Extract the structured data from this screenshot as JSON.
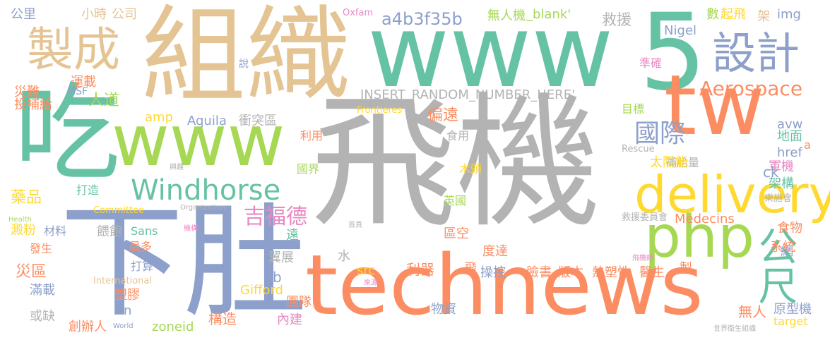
{
  "palette": {
    "green": "#66c2a5",
    "orange": "#fc8d62",
    "blue": "#8da0cb",
    "pink": "#e78ac3",
    "lime": "#a6d854",
    "yellow": "#ffd92f",
    "tan": "#e5c494",
    "gray": "#b3b3b3"
  },
  "words": [
    {
      "text": "飛機",
      "color": "#b3b3b3"
    },
    {
      "text": "組織",
      "color": "#e5c494"
    },
    {
      "text": "www",
      "color": "#66c2a5"
    },
    {
      "text": "5",
      "color": "#66c2a5"
    },
    {
      "text": "technews",
      "color": "#fc8d62"
    },
    {
      "text": "www",
      "color": "#a6d854"
    },
    {
      "text": "吃",
      "color": "#66c2a5"
    },
    {
      "text": "下肚",
      "color": "#8da0cb"
    },
    {
      "text": "tw",
      "color": "#fc8d62"
    },
    {
      "text": "delivery",
      "color": "#ffd92f"
    },
    {
      "text": "製成",
      "color": "#e5c494"
    },
    {
      "text": "設計",
      "color": "#8da0cb"
    },
    {
      "text": "php",
      "color": "#a6d854"
    },
    {
      "text": "公尺",
      "color": "#66c2a5"
    },
    {
      "text": "Windhorse",
      "color": "#66c2a5"
    },
    {
      "text": "Aerospace",
      "color": "#fc8d62"
    },
    {
      "text": "國際",
      "color": "#8da0cb"
    },
    {
      "text": "吉福德",
      "color": "#e78ac3"
    },
    {
      "text": "INSERT_RANDOM_NUMBER_HERE'",
      "color": "#b3b3b3"
    },
    {
      "text": "a4b3f35b",
      "color": "#8da0cb"
    },
    {
      "text": "無人機",
      "color": "#a6d854"
    },
    {
      "text": "_blank'",
      "color": "#a6d854"
    },
    {
      "text": "救援",
      "color": "#b3b3b3"
    },
    {
      "text": "Nigel",
      "color": "#8da0cb"
    },
    {
      "text": "起飛",
      "color": "#ffd92f"
    },
    {
      "text": "數",
      "color": "#a6d854"
    },
    {
      "text": "架",
      "color": "#e5c494"
    },
    {
      "text": "img",
      "color": "#8da0cb"
    },
    {
      "text": "Oxfam",
      "color": "#e78ac3"
    },
    {
      "text": "公里",
      "color": "#8da0cb"
    },
    {
      "text": "小時",
      "color": "#e5c494"
    },
    {
      "text": "公司",
      "color": "#e5c494"
    },
    {
      "text": "說",
      "color": "#8da0cb"
    },
    {
      "text": "運載",
      "color": "#fc8d62"
    },
    {
      "text": "災難",
      "color": "#fc8d62"
    },
    {
      "text": "MSF",
      "color": "#8da0cb"
    },
    {
      "text": "投補給",
      "color": "#fc8d62"
    },
    {
      "text": "人道",
      "color": "#a6d854"
    },
    {
      "text": "準確",
      "color": "#e78ac3"
    },
    {
      "text": "目標",
      "color": "#a6d854"
    },
    {
      "text": "avw",
      "color": "#8da0cb"
    },
    {
      "text": "地面",
      "color": "#66c2a5"
    },
    {
      "text": "a",
      "color": "#fc8d62"
    },
    {
      "text": "amp",
      "color": "#ffd92f"
    },
    {
      "text": "Aquila",
      "color": "#8da0cb"
    },
    {
      "text": "衝突區",
      "color": "#b3b3b3"
    },
    {
      "text": "偏遠",
      "color": "#fc8d62"
    },
    {
      "text": "Frontieres",
      "color": "#ffd92f"
    },
    {
      "text": "食用",
      "color": "#b3b3b3"
    },
    {
      "text": "href",
      "color": "#8da0cb"
    },
    {
      "text": "利用",
      "color": "#fc8d62"
    },
    {
      "text": "Rescue",
      "color": "#b3b3b3"
    },
    {
      "text": "軍機",
      "color": "#e78ac3"
    },
    {
      "text": "國界",
      "color": "#a6d854"
    },
    {
      "text": "木頭",
      "color": "#ffd92f"
    },
    {
      "text": "補給量",
      "color": "#b3b3b3"
    },
    {
      "text": "太陽能",
      "color": "#ffd92f"
    },
    {
      "text": "架構",
      "color": "#66c2a5"
    },
    {
      "text": "ck",
      "color": "#8da0cb"
    },
    {
      "text": "樂施會",
      "color": "#b3b3b3"
    },
    {
      "text": "藥品",
      "color": "#ffd92f"
    },
    {
      "text": "打造",
      "color": "#66c2a5"
    },
    {
      "text": "興趣",
      "color": "#b3b3b3"
    },
    {
      "text": "Committee",
      "color": "#ffd92f"
    },
    {
      "text": "Organization",
      "color": "#b3b3b3"
    },
    {
      "text": "英國",
      "color": "#a6d854"
    },
    {
      "text": "Health",
      "color": "#a6d854"
    },
    {
      "text": "機構",
      "color": "#e78ac3"
    },
    {
      "text": "首頁",
      "color": "#b3b3b3"
    },
    {
      "text": "救援委員會",
      "color": "#b3b3b3"
    },
    {
      "text": "Medecins",
      "color": "#fc8d62"
    },
    {
      "text": "食物",
      "color": "#fc8d62"
    },
    {
      "text": "網",
      "color": "#8da0cb"
    },
    {
      "text": "澱粉",
      "color": "#ffd92f"
    },
    {
      "text": "材料",
      "color": "#8da0cb"
    },
    {
      "text": "餵飽",
      "color": "#b3b3b3"
    },
    {
      "text": "Sans",
      "color": "#66c2a5"
    },
    {
      "text": "遠",
      "color": "#66c2a5"
    },
    {
      "text": "區空",
      "color": "#fc8d62"
    },
    {
      "text": "系統",
      "color": "#fc8d62"
    },
    {
      "text": "發生",
      "color": "#fc8d62"
    },
    {
      "text": "最多",
      "color": "#fc8d62"
    },
    {
      "text": "翼展",
      "color": "#b3b3b3"
    },
    {
      "text": "水",
      "color": "#b3b3b3"
    },
    {
      "text": "度達",
      "color": "#fc8d62"
    },
    {
      "text": "飛機師",
      "color": "#e78ac3"
    },
    {
      "text": "災區",
      "color": "#fc8d62"
    },
    {
      "text": "打算",
      "color": "#8da0cb"
    },
    {
      "text": "International",
      "color": "#e5c494"
    },
    {
      "text": "cb",
      "color": "#8da0cb"
    },
    {
      "text": "src",
      "color": "#ffd92f"
    },
    {
      "text": "利器",
      "color": "#fc8d62"
    },
    {
      "text": "飛",
      "color": "#fc8d62"
    },
    {
      "text": "操控",
      "color": "#8da0cb"
    },
    {
      "text": "臉書",
      "color": "#fc8d62"
    },
    {
      "text": "版本",
      "color": "#fc8d62"
    },
    {
      "text": "熱塑性",
      "color": "#fc8d62"
    },
    {
      "text": "醫生",
      "color": "#fc8d62"
    },
    {
      "text": "製",
      "color": "#fc8d62"
    },
    {
      "text": "滿載",
      "color": "#8da0cb"
    },
    {
      "text": "塑膠",
      "color": "#fc8d62"
    },
    {
      "text": "Gifford",
      "color": "#ffd92f"
    },
    {
      "text": "來源",
      "color": "#e78ac3"
    },
    {
      "text": "團隊",
      "color": "#fc8d62"
    },
    {
      "text": "物資",
      "color": "#8da0cb"
    },
    {
      "text": "無人",
      "color": "#fc8d62"
    },
    {
      "text": "原型機",
      "color": "#8da0cb"
    },
    {
      "text": "n",
      "color": "#8da0cb"
    },
    {
      "text": "或缺",
      "color": "#b3b3b3"
    },
    {
      "text": "構造",
      "color": "#fc8d62"
    },
    {
      "text": "創辦人",
      "color": "#fc8d62"
    },
    {
      "text": "World",
      "color": "#8da0cb"
    },
    {
      "text": "zoneid",
      "color": "#a6d854"
    },
    {
      "text": "內建",
      "color": "#e78ac3"
    },
    {
      "text": "target",
      "color": "#ffd92f"
    },
    {
      "text": "世界衛生組織",
      "color": "#b3b3b3"
    }
  ]
}
